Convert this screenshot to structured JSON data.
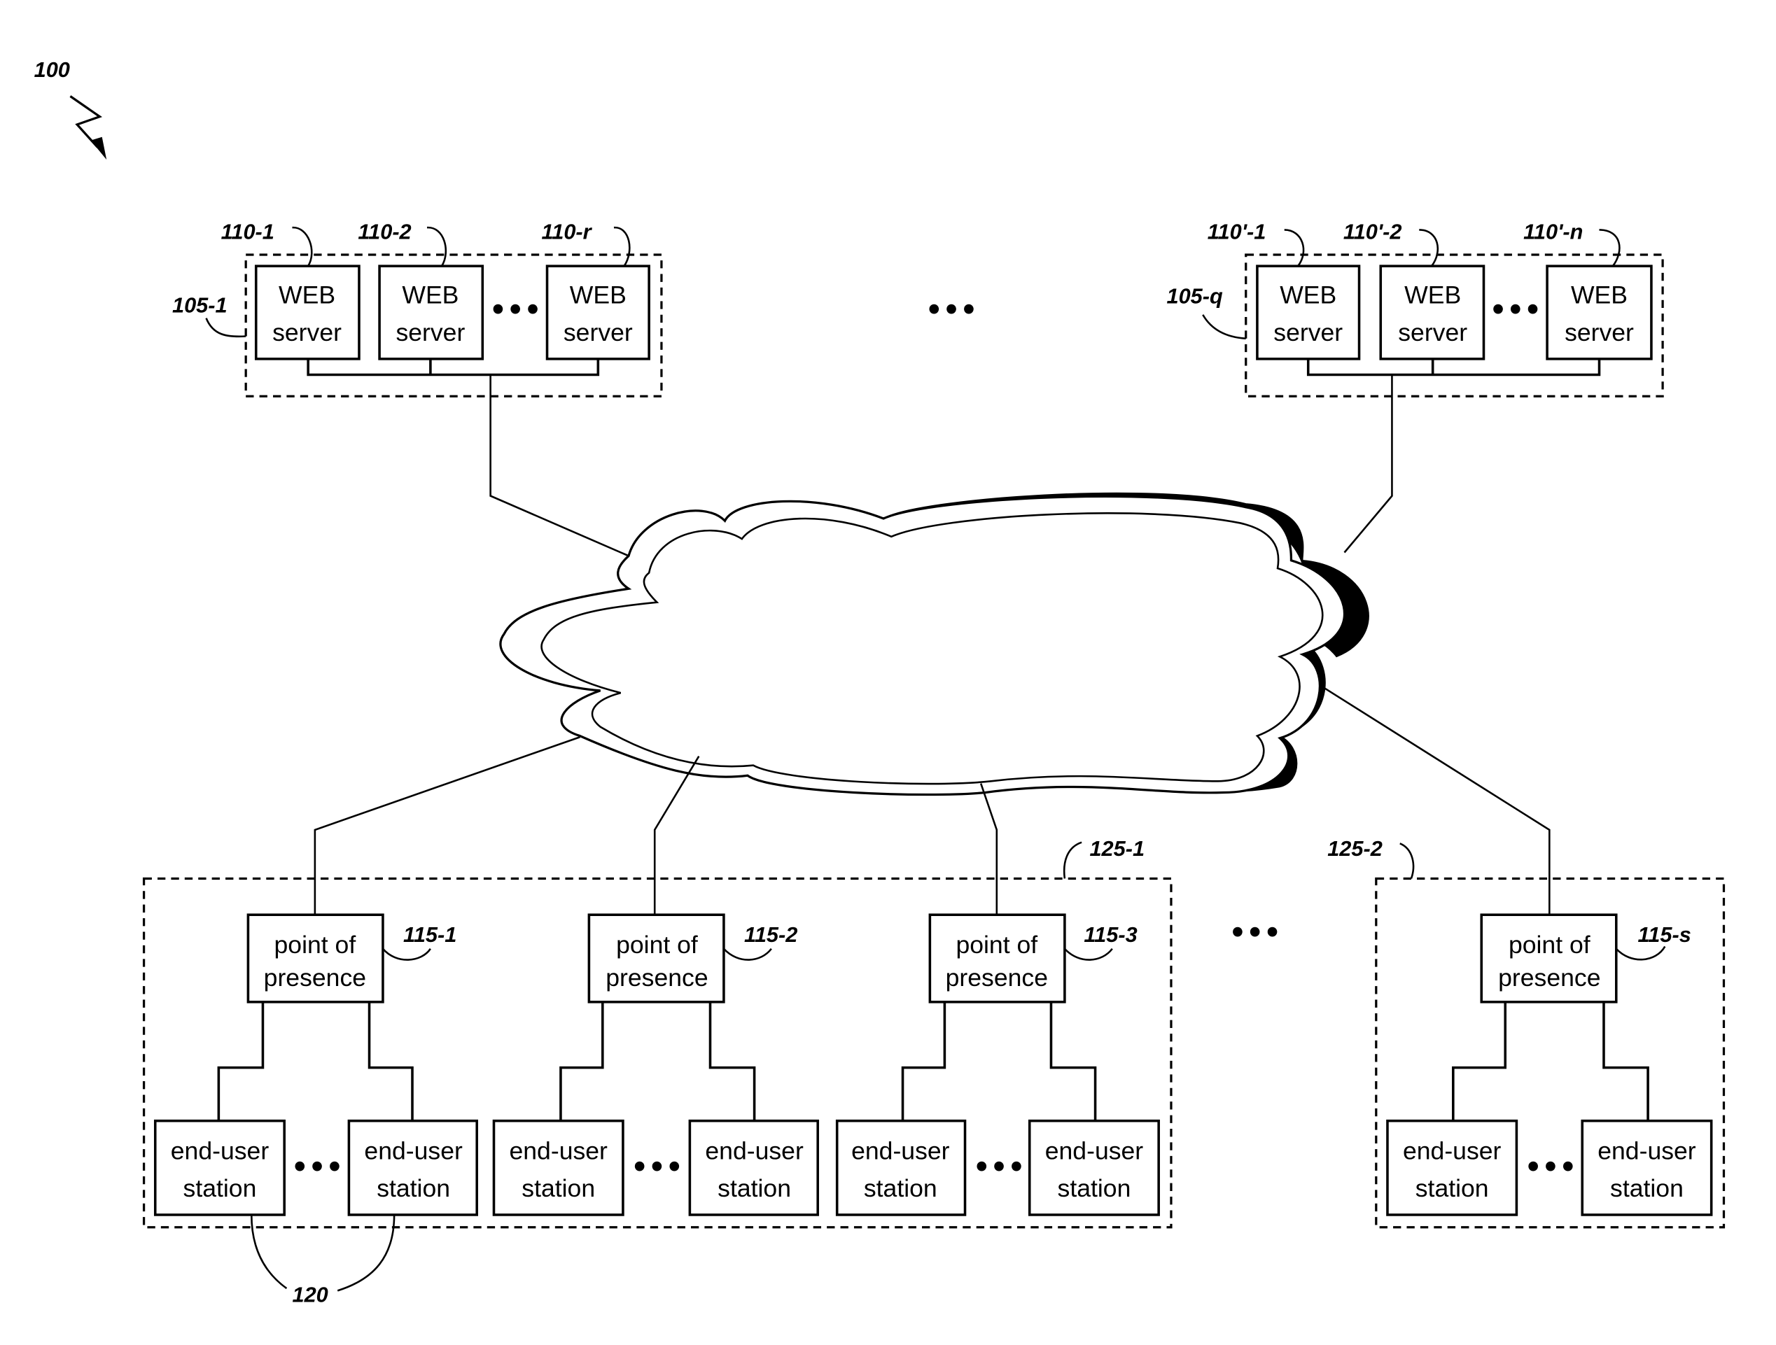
{
  "figure": {
    "ref": "100"
  },
  "server_clusters": [
    {
      "ref": "105-1",
      "servers": [
        {
          "ref": "110-1",
          "line1": "WEB",
          "line2": "server"
        },
        {
          "ref": "110-2",
          "line1": "WEB",
          "line2": "server"
        },
        {
          "ref": "110-r",
          "line1": "WEB",
          "line2": "server"
        }
      ]
    },
    {
      "ref": "105-q",
      "servers": [
        {
          "ref": "110'-1",
          "line1": "WEB",
          "line2": "server"
        },
        {
          "ref": "110'-2",
          "line1": "WEB",
          "line2": "server"
        },
        {
          "ref": "110'-n",
          "line1": "WEB",
          "line2": "server"
        }
      ]
    }
  ],
  "ellipsis": "•••",
  "regions": [
    {
      "ref": "125-1"
    },
    {
      "ref": "125-2"
    }
  ],
  "pops": [
    {
      "ref": "115-1",
      "line1": "point of",
      "line2": "presence"
    },
    {
      "ref": "115-2",
      "line1": "point of",
      "line2": "presence"
    },
    {
      "ref": "115-3",
      "line1": "point of",
      "line2": "presence"
    },
    {
      "ref": "115-s",
      "line1": "point of",
      "line2": "presence"
    }
  ],
  "station": {
    "line1": "end-user",
    "line2": "station"
  },
  "stations_ref": "120"
}
